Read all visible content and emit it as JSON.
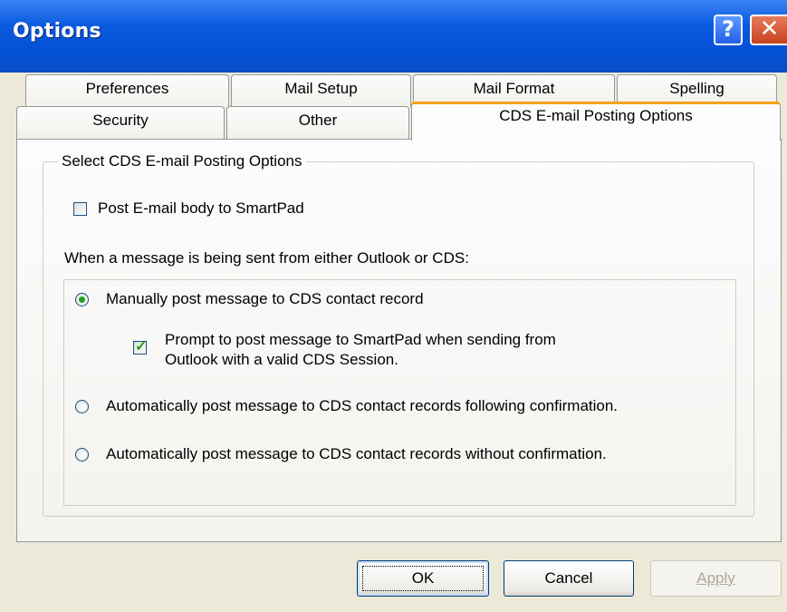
{
  "window": {
    "title": "Options",
    "help_glyph": "?",
    "close_glyph": "✕"
  },
  "tabs": {
    "row1": [
      "Preferences",
      "Mail Setup",
      "Mail Format",
      "Spelling"
    ],
    "row2": [
      "Security",
      "Other",
      "CDS E-mail Posting Options"
    ],
    "active": "CDS E-mail Posting Options"
  },
  "group": {
    "title": "Select CDS E-mail Posting Options",
    "post_body_label": "Post E-mail body to SmartPad",
    "post_body_checked": false,
    "when_label": "When a message is being sent from either Outlook or CDS:",
    "options": [
      {
        "label": "Manually post message to CDS contact record",
        "selected": true
      },
      {
        "label": "Automatically post message to CDS contact records following confirmation.",
        "selected": false
      },
      {
        "label": "Automatically post message to CDS contact records without confirmation.",
        "selected": false
      }
    ],
    "prompt_line1": "Prompt to post message to SmartPad when sending from",
    "prompt_line2": "Outlook with a valid CDS Session.",
    "prompt_checked": true
  },
  "buttons": {
    "ok": "OK",
    "cancel": "Cancel",
    "apply": "Apply",
    "apply_enabled": false
  },
  "colors": {
    "titlebar": "#0a5ae0",
    "dialog_bg": "#ece9d8",
    "active_tab_accent": "#f5a10c",
    "check_green": "#21a121"
  }
}
